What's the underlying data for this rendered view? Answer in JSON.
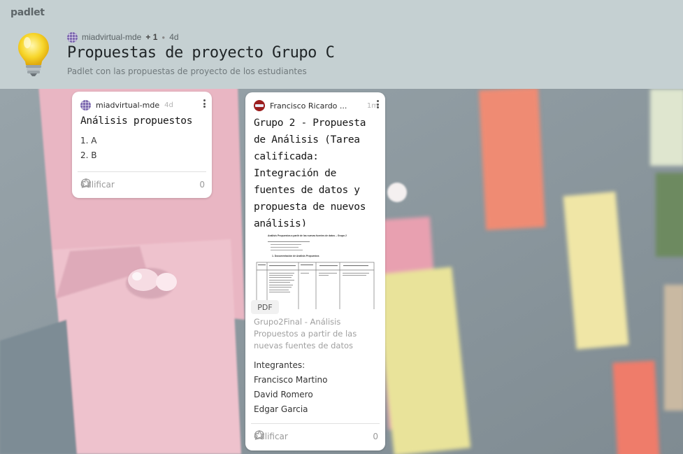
{
  "app": {
    "brand": "padlet"
  },
  "header": {
    "author": "miadvirtual-mde",
    "contributors": "+ 1",
    "age": "4d",
    "title": "Propuestas de proyecto Grupo C",
    "subtitle": "Padlet con las propuestas de proyecto de los estudiantes",
    "icon": "lightbulb-icon"
  },
  "cards": [
    {
      "author": "miadvirtual-mde",
      "time": "4d",
      "title": "Análisis propuestos",
      "items": [
        "1. A",
        "2. B"
      ],
      "rate_label": "Calificar",
      "comment_count": "0"
    },
    {
      "author": "Francisco Ricardo ...",
      "time": "1m",
      "title": "Grupo 2 - Propuesta de Análisis (Tarea calificada: Integración de fuentes de datos y propuesta de nuevos análisis)",
      "attachment": {
        "type": "PDF",
        "caption": "Grupo2Final - Análisis Propuestos a partir de las nuevas fuentes de datos",
        "preview_heading": "Análisis Propuestos a partir de las nuevas fuentes de datos – Grupo 2",
        "preview_section": "1. Documentación de Análisis Propuestos"
      },
      "members_label": "Integrantes:",
      "members": [
        "Francisco Martino",
        "David Romero",
        "Edgar Garcia"
      ],
      "rate_label": "Calificar",
      "comment_count": "0"
    }
  ],
  "colors": {
    "accent": "#5b6366",
    "card_bg": "#ffffff",
    "header_bg": "#c5d0d2"
  }
}
